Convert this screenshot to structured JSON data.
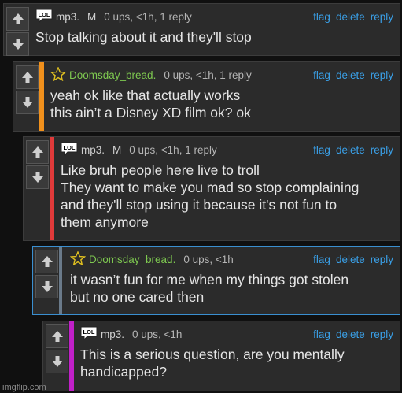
{
  "comments": [
    {
      "badge": "LOL",
      "username": "mp3.",
      "mod_flag": "M",
      "meta": "0 ups, <1h, 1 reply",
      "actions": [
        "flag",
        "delete",
        "reply"
      ],
      "text": "Stop talking about it and they'll stop",
      "bar_color": null
    },
    {
      "badge": "☆",
      "username": "Doomsday_bread.",
      "meta": "0 ups, <1h, 1 reply",
      "actions": [
        "flag",
        "delete",
        "reply"
      ],
      "text": "yeah ok like that actually works\nthis ain’t a Disney XD film ok? ok",
      "bar_color": "#f0901c"
    },
    {
      "badge": "LOL",
      "username": "mp3.",
      "mod_flag": "M",
      "meta": "0 ups, <1h, 1 reply",
      "actions": [
        "flag",
        "delete",
        "reply"
      ],
      "text": "Like bruh people here live to troll\nThey want to make you mad so stop complaining\nand they'll stop using it because it's not fun to\nthem anymore",
      "bar_color": "#e03a3a"
    },
    {
      "badge": "☆",
      "username": "Doomsday_bread.",
      "meta": "0 ups, <1h",
      "actions": [
        "flag",
        "delete",
        "reply"
      ],
      "text": "it wasn’t fun for me when my things got stolen\nbut no one cared then",
      "bar_color": "#6a7a8a"
    },
    {
      "badge": "LOL",
      "username": "mp3.",
      "meta": "0 ups, <1h",
      "actions": [
        "flag",
        "delete",
        "reply"
      ],
      "text": "This is a serious question, are you mentally\nhandicapped?",
      "bar_color": "#c020c8"
    }
  ],
  "watermark": "imgflip.com",
  "colors": {
    "link": "#3aa0e8",
    "green_user": "#7ec850"
  },
  "icons": {
    "upvote": "up-arrow-icon",
    "downvote": "down-arrow-icon"
  }
}
